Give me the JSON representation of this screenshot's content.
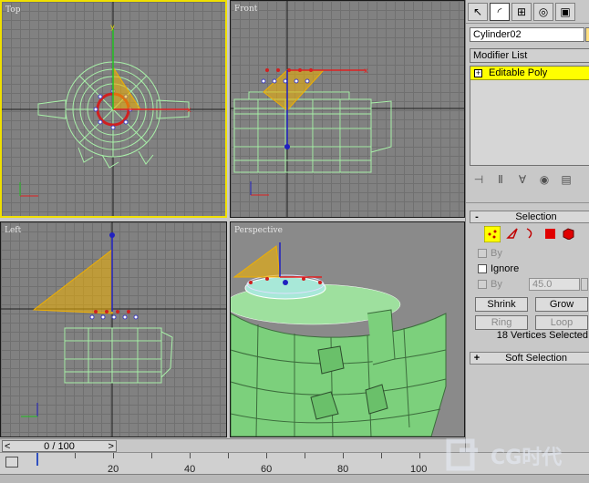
{
  "viewports": {
    "top": "Top",
    "front": "Front",
    "left": "Left",
    "perspective": "Perspective"
  },
  "panel": {
    "tabs": [
      "create-icon",
      "modify-icon",
      "hierarchy-icon",
      "motion-icon",
      "display-icon",
      "utilities-icon"
    ],
    "object_name": "Cylinder02",
    "modifier_list": "Modifier List",
    "stack_item": "Editable Poly",
    "selection": {
      "title": "Selection",
      "by_vertex": "By",
      "ignore_backfacing": "Ignore",
      "by_angle": "By",
      "angle_value": "45.0",
      "shrink": "Shrink",
      "grow": "Grow",
      "ring": "Ring",
      "loop": "Loop",
      "status": "18 Vertices Selected"
    },
    "soft_selection": "Soft Selection",
    "swatch_color": "#ffe080",
    "stack_highlight": "#ffff00"
  },
  "timeline": {
    "frame": "0 / 100",
    "ticks": [
      "20",
      "40",
      "60",
      "80",
      "100"
    ]
  },
  "watermark": "CG时代",
  "colors": {
    "viewport_bg": "#818181",
    "active_border": "#f0e000",
    "wire": "#a8f0a8",
    "gizmo": "#f0b000"
  }
}
